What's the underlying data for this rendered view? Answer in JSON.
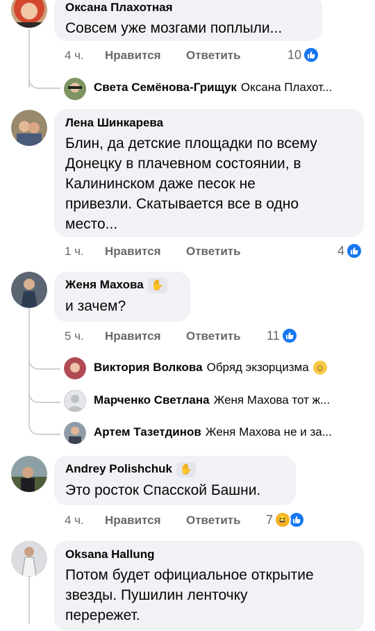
{
  "colors": {
    "bubble": "#f0f2f5",
    "like_blue": "#1877f2",
    "meta_gray": "#65676b",
    "line": "#ced0d4"
  },
  "comments": [
    {
      "author": "Оксана Плахотная",
      "text": "Совсем уже мозгами поплыли...",
      "time": "4 ч.",
      "like_label": "Нравится",
      "reply_label": "Ответить",
      "reaction_count": "10",
      "reaction_icons": [
        "like-icon"
      ],
      "replies": [
        {
          "author": "Света Семёнова-Грищук",
          "text": "Оксана Плахот..."
        }
      ]
    },
    {
      "author": "Лена Шинкарева",
      "text": [
        "Блин, да детские площадки по всему",
        "Донецку в плачевном состоянии, в",
        "Калининском даже песок не",
        "привезли. Скатывается все в одно",
        "место..."
      ],
      "time": "1 ч.",
      "like_label": "Нравится",
      "reply_label": "Ответить",
      "reaction_count": "4",
      "reaction_icons": [
        "like-icon"
      ]
    },
    {
      "author": "Женя Махова",
      "badge": "wave-icon",
      "text": "и зачем?",
      "time": "5 ч.",
      "like_label": "Нравится",
      "reply_label": "Ответить",
      "reaction_count": "11",
      "reaction_icons": [
        "like-icon"
      ],
      "replies": [
        {
          "author": "Виктория Волкова",
          "text": "Обряд экзорцизма",
          "emoji": "smile-emoji"
        },
        {
          "author": "Марченко Светлана",
          "text": "Женя Махова тот ж..."
        },
        {
          "author": "Артем Тазетдинов",
          "text": "Женя Махова не и за..."
        }
      ]
    },
    {
      "author": "Andrey Polishchuk",
      "badge": "wave-icon",
      "text": "Это росток Спасской Башни.",
      "time": "4 ч.",
      "like_label": "Нравится",
      "reply_label": "Ответить",
      "reaction_count": "7",
      "reaction_icons": [
        "haha-icon",
        "like-icon"
      ]
    },
    {
      "author": "Oksana Hallung",
      "text": [
        "Потом будет официальное открытие",
        "звезды. Пушилин ленточку",
        "перережет."
      ]
    }
  ]
}
